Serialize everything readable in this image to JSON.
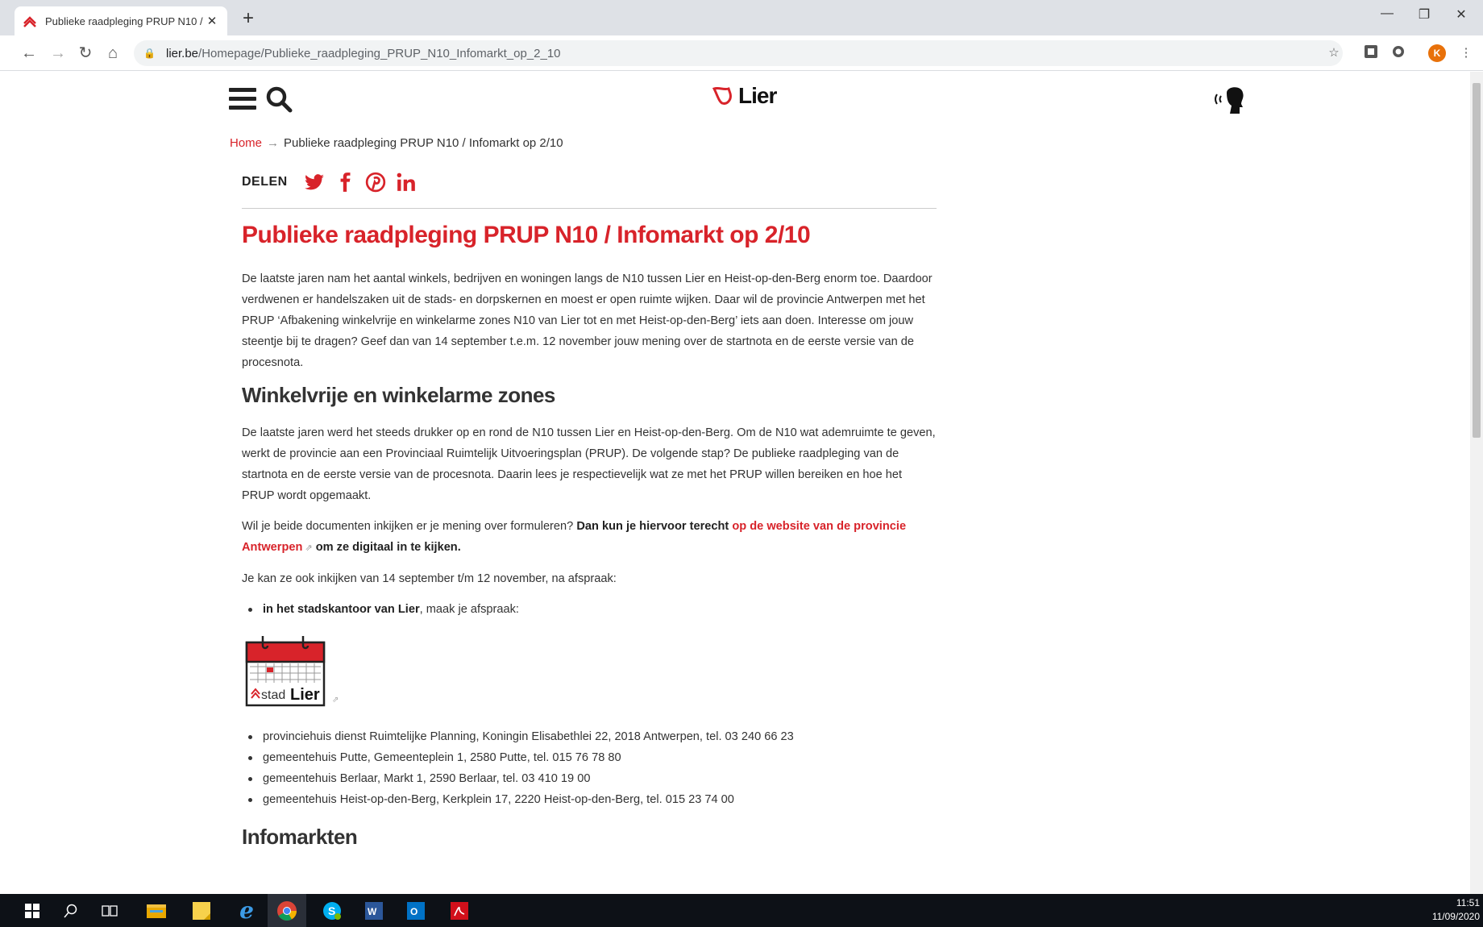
{
  "browser": {
    "tab_title": "Publieke raadpleging PRUP N10 /",
    "new_tab": "+",
    "url_host": "lier.be",
    "url_path": "/Homepage/Publieke_raadpleging_PRUP_N10_Infomarkt_op_2_10",
    "avatar_letter": "K"
  },
  "header": {
    "logo_text": "Lier"
  },
  "breadcrumb": {
    "home": "Home",
    "separator": "→",
    "current": "Publieke raadpleging PRUP N10 / Infomarkt op 2/10"
  },
  "share": {
    "label": "DELEN"
  },
  "article": {
    "title": "Publieke raadpleging PRUP N10 / Infomarkt op 2/10",
    "intro": "De laatste jaren nam het aantal winkels, bedrijven en woningen langs de N10 tussen Lier en Heist-op-den-Berg enorm toe. Daardoor verdwenen er handelszaken uit de stads- en dorpskernen en moest er open ruimte wijken. Daar wil de provincie Antwerpen met het PRUP ‘Afbakening winkelvrije en winkelarme zones N10 van Lier tot en met Heist-op-den-Berg’ iets aan doen. Interesse om jouw steentje bij te dragen? Geef dan van 14 september t.e.m. 12 november jouw mening over de startnota en de eerste versie van de procesnota.",
    "h2_zones": "Winkelvrije en winkelarme zones",
    "zones_text": "De laatste jaren werd het steeds drukker op en rond de N10 tussen Lier en Heist-op-den-Berg. Om de N10 wat ademruimte te geven, werkt de provincie aan een Provinciaal Ruimtelijk Uitvoeringsplan (PRUP). De volgende stap? De publieke raadpleging van de startnota en de eerste versie van de procesnota. Daarin lees je respectievelijk wat ze met het PRUP willen bereiken en hoe het PRUP wordt opgemaakt.",
    "docs_prefix": "Wil je beide documenten inkijken er je mening over formuleren? ",
    "docs_bold": "Dan kun je hiervoor terecht ",
    "docs_link": "op de website van de provincie Antwerpen",
    "docs_suffix": " om ze digitaal in te kijken.",
    "inspect_text": "Je kan ze ook inkijken van 14 september t/m 12 november, na afspraak:",
    "bullet1_bold": "in het stadskantoor van Lier",
    "bullet1_rest": ", maak je afspraak:",
    "calendar_stad": "stad",
    "calendar_lier": "Lier",
    "locations": [
      "provinciehuis dienst Ruimtelijke Planning, Koningin Elisabethlei 22, 2018 Antwerpen, tel. 03 240 66 23",
      "gemeentehuis Putte, Gemeenteplein 1, 2580 Putte, tel. 015 76 78 80",
      "gemeentehuis Berlaar, Markt 1, 2590 Berlaar, tel. 03 410 19 00",
      "gemeentehuis Heist-op-den-Berg, Kerkplein 17, 2220 Heist-op-den-Berg, tel. 015 23 74 00"
    ],
    "h2_infomarkten": "Infomarkten"
  },
  "taskbar": {
    "time": "11:51",
    "date": "11/09/2020"
  },
  "colors": {
    "brand_red": "#d8232a"
  }
}
